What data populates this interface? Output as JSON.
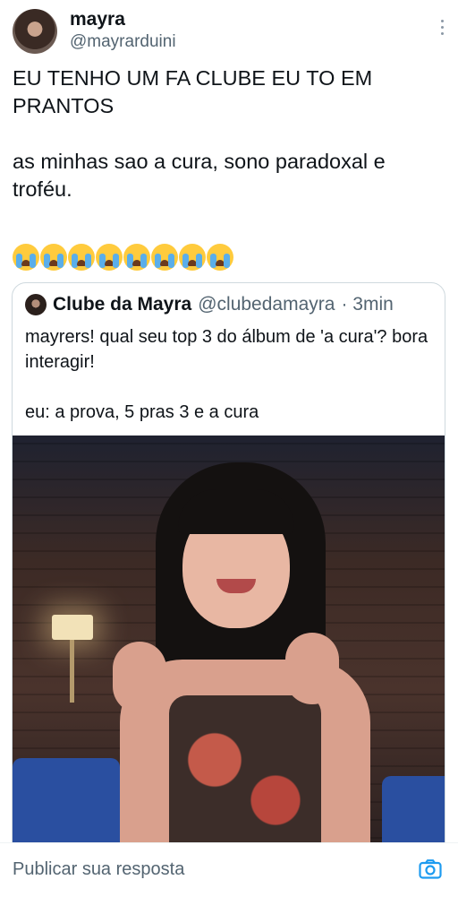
{
  "author": {
    "name": "mayra",
    "handle": "@mayrarduini"
  },
  "tweet": {
    "lines": [
      "EU TENHO UM FA CLUBE EU TO EM PRANTOS",
      "as minhas sao a cura, sono paradoxal e troféu."
    ],
    "emoji_count": 8,
    "emoji_name": "loudly-crying-face"
  },
  "quote": {
    "name": "Clube da Mayra",
    "handle": "@clubedamayra",
    "time": "· 3min",
    "text_line1": "mayrers! qual seu top 3 do álbum de 'a cura'? bora interagir!",
    "text_line2": "eu: a prova, 5 pras 3 e a cura"
  },
  "reply": {
    "placeholder": "Publicar sua resposta"
  },
  "colors": {
    "accent": "#1d9bf0",
    "muted": "#536471",
    "border": "#cfd9de"
  }
}
